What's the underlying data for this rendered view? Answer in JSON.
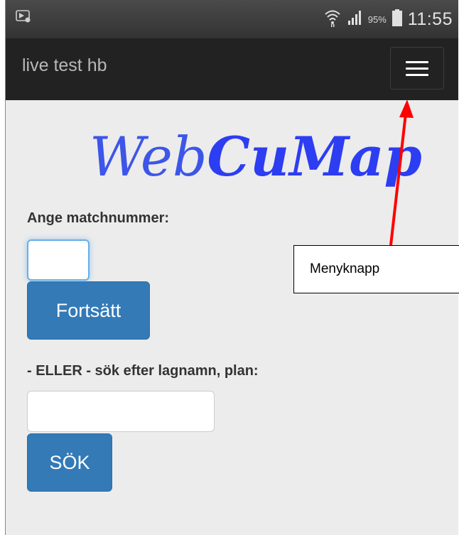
{
  "status_bar": {
    "battery_percent": "95%",
    "time": "11:55",
    "icons": [
      "screenshot-notification-icon",
      "wifi-icon",
      "signal-icon",
      "battery-icon"
    ]
  },
  "navbar": {
    "brand": "live test hb",
    "menu_icon": "hamburger-menu-icon"
  },
  "logo": {
    "part1": "Web",
    "part2": "CuMap"
  },
  "match_form": {
    "label": "Ange matchnummer:",
    "input_value": "",
    "button_label": "Fortsätt"
  },
  "search_form": {
    "label": "- ELLER - sök efter lagnamn, plan:",
    "input_value": "",
    "button_label": "SÖK"
  },
  "annotation": {
    "callout_text": "Menyknapp",
    "arrow_color": "#ff0000"
  },
  "colors": {
    "primary_button": "#337ab7",
    "navbar": "#222222",
    "page_background": "#ececec",
    "logo": "#2c3df2"
  }
}
